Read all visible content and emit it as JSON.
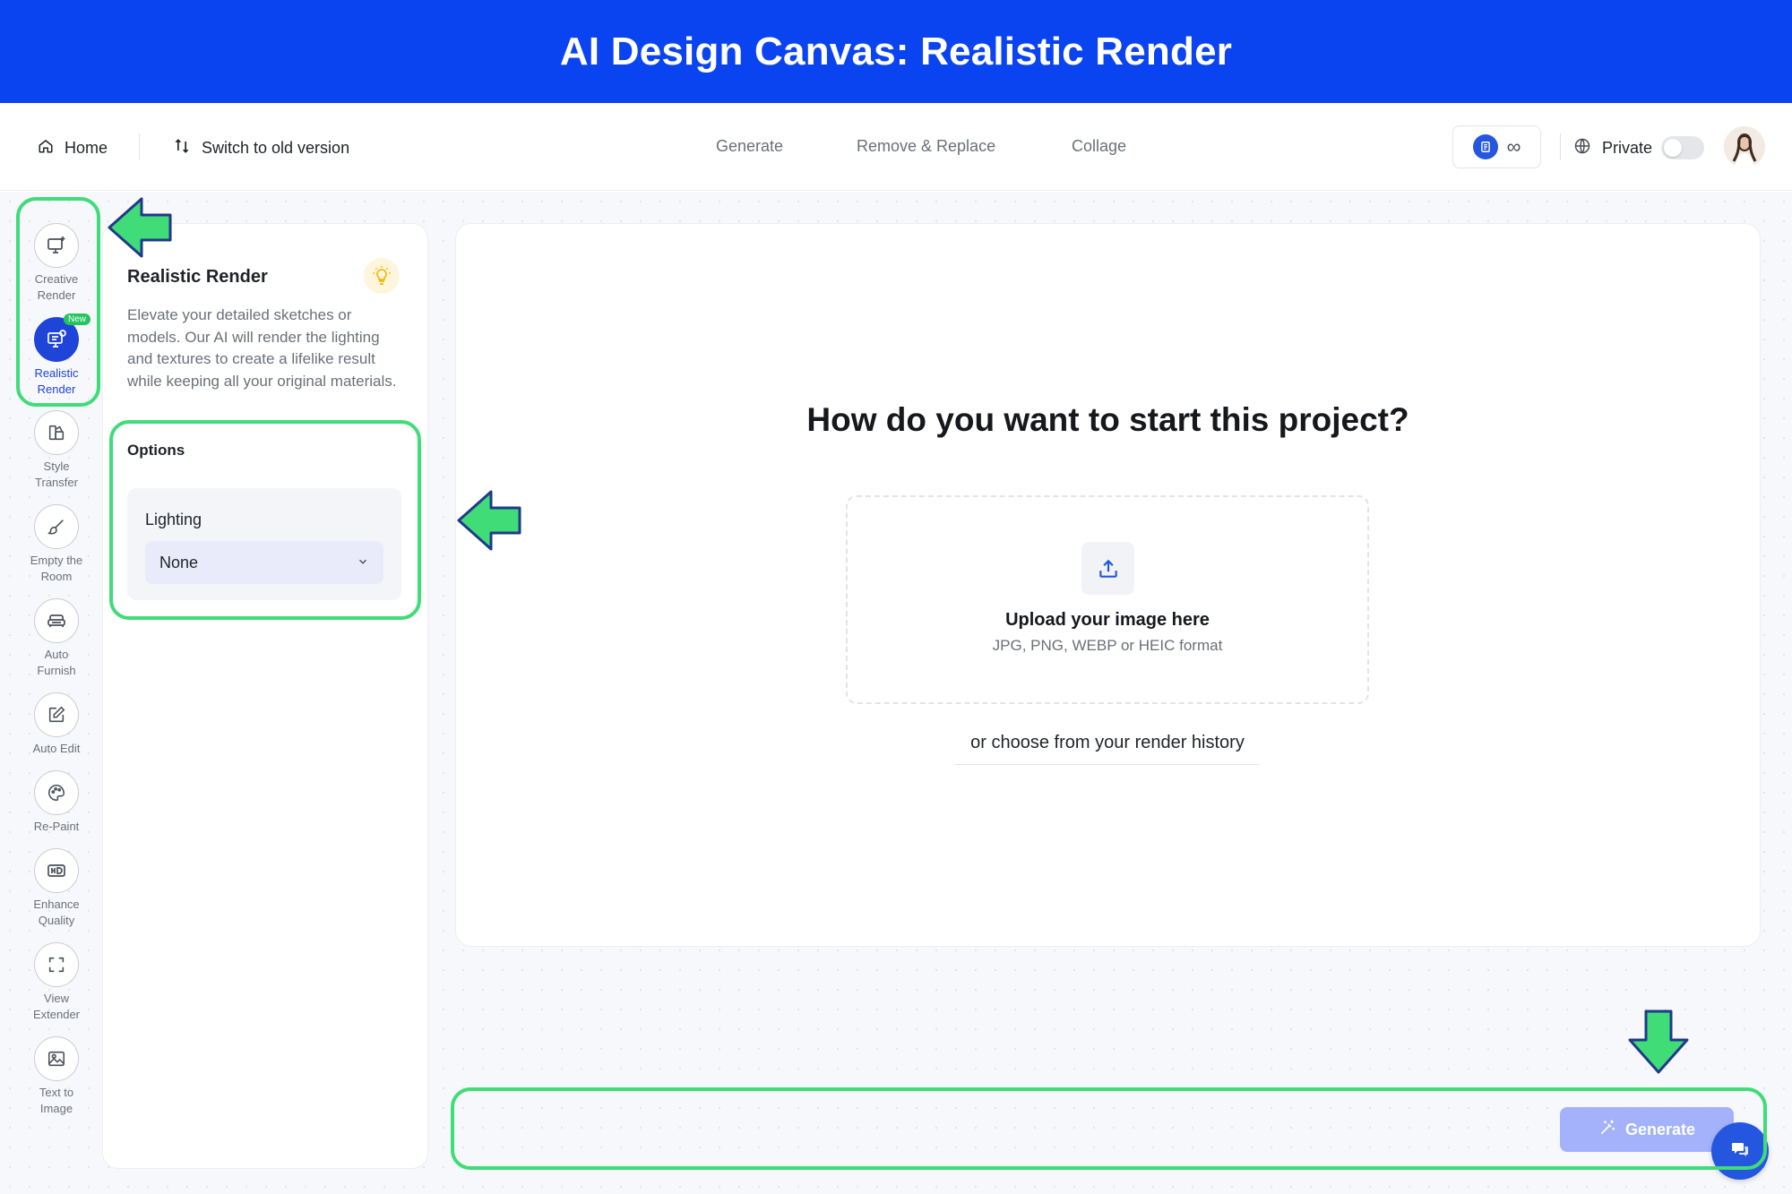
{
  "banner": {
    "title": "AI Design Canvas: Realistic Render"
  },
  "nav": {
    "home": "Home",
    "switch_version": "Switch to old version",
    "tabs": [
      "Generate",
      "Remove & Replace",
      "Collage"
    ],
    "credits": "∞",
    "privacy": "Private"
  },
  "tools": [
    {
      "line1": "Creative",
      "line2": "Render",
      "icon": "creative-render-icon"
    },
    {
      "line1": "Realistic",
      "line2": "Render",
      "icon": "realistic-render-icon",
      "badge": "New",
      "active": true
    },
    {
      "line1": "Style",
      "line2": "Transfer",
      "icon": "style-transfer-icon"
    },
    {
      "line1": "Empty the",
      "line2": "Room",
      "icon": "brush-icon"
    },
    {
      "line1": "Auto",
      "line2": "Furnish",
      "icon": "sofa-icon"
    },
    {
      "line1": "Auto Edit",
      "line2": "",
      "icon": "edit-icon"
    },
    {
      "line1": "Re-Paint",
      "line2": "",
      "icon": "palette-icon"
    },
    {
      "line1": "Enhance",
      "line2": "Quality",
      "icon": "hd-icon"
    },
    {
      "line1": "View",
      "line2": "Extender",
      "icon": "expand-icon"
    },
    {
      "line1": "Text to",
      "line2": "Image",
      "icon": "image-icon"
    }
  ],
  "panel": {
    "title": "Realistic Render",
    "description": "Elevate your detailed sketches or models. Our AI will render the lighting and textures to create a lifelike result while keeping all your original materials.",
    "options_title": "Options",
    "lighting_label": "Lighting",
    "lighting_value": "None"
  },
  "main": {
    "heading": "How do you want to start this project?",
    "upload_title": "Upload your image here",
    "upload_formats": "JPG, PNG, WEBP or HEIC format",
    "history_link": "or choose from your render history"
  },
  "generate": {
    "label": "Generate"
  },
  "colors": {
    "banner": "#0a44f0",
    "accent": "#1f44d8",
    "highlight": "#3fdc78",
    "generate_disabled": "#a3b2fb"
  }
}
